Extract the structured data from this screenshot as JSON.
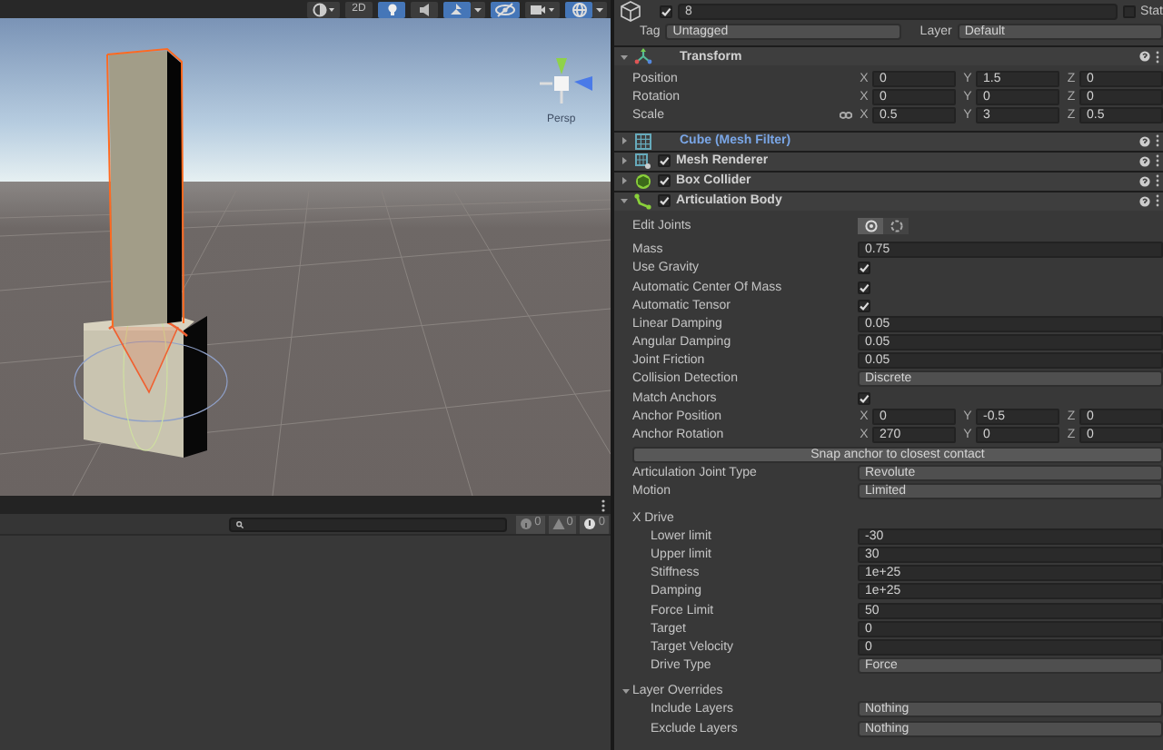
{
  "scene_toolbar": [
    {
      "kind": "shading",
      "on": false
    },
    {
      "kind": "dimension",
      "label": "2D",
      "on": false
    },
    {
      "kind": "lighting",
      "on": true
    },
    {
      "kind": "audio",
      "on": false
    },
    {
      "kind": "effects",
      "on": true
    },
    {
      "kind": "visibility",
      "on": true
    },
    {
      "kind": "camera",
      "on": false
    },
    {
      "kind": "gizmos",
      "on": true
    }
  ],
  "scene": {
    "projection_label": "Persp"
  },
  "console": {
    "counts": [
      {
        "kind": "info",
        "count": "0"
      },
      {
        "kind": "warning",
        "count": "0"
      },
      {
        "kind": "error",
        "count": "0"
      }
    ]
  },
  "inspector": {
    "object": {
      "active": true,
      "name": "8",
      "static_checked": false,
      "static_label": "Stat",
      "tag_label": "Tag",
      "tag": "Untagged",
      "layer_label": "Layer",
      "layer": "Default"
    },
    "components": [
      {
        "kind": "transform",
        "name": "Transform",
        "expanded": true,
        "fields": [
          {
            "label": "Position",
            "linked": false,
            "values": [
              {
                "axis": "X",
                "value": "0"
              },
              {
                "axis": "Y",
                "value": "1.5"
              },
              {
                "axis": "Z",
                "value": "0"
              }
            ]
          },
          {
            "label": "Rotation",
            "linked": false,
            "values": [
              {
                "axis": "X",
                "value": "0"
              },
              {
                "axis": "Y",
                "value": "0"
              },
              {
                "axis": "Z",
                "value": "0"
              }
            ]
          },
          {
            "label": "Scale",
            "linked": true,
            "values": [
              {
                "axis": "X",
                "value": "0.5"
              },
              {
                "axis": "Y",
                "value": "3"
              },
              {
                "axis": "Z",
                "value": "0.5"
              }
            ]
          }
        ]
      },
      {
        "kind": "mesh_filter",
        "name": "Cube (Mesh Filter)",
        "expanded": false
      },
      {
        "kind": "mesh_renderer",
        "name": "Mesh Renderer",
        "expanded": false,
        "enabled": true
      },
      {
        "kind": "box_collider",
        "name": "Box Collider",
        "expanded": false,
        "enabled": true
      },
      {
        "kind": "articulation_body",
        "name": "Articulation Body",
        "expanded": true,
        "enabled": true,
        "properties": [
          {
            "kind": "edit_joints",
            "label": "Edit Joints",
            "modes": [
              {
                "selected": true
              },
              {
                "selected": false
              }
            ]
          },
          {
            "kind": "number",
            "label": "Mass",
            "value": "0.75"
          },
          {
            "kind": "checkbox",
            "label": "Use Gravity",
            "checked": true
          },
          {
            "kind": "checkbox",
            "label": "Automatic Center Of Mass",
            "checked": true
          },
          {
            "kind": "checkbox",
            "label": "Automatic Tensor",
            "checked": true
          },
          {
            "kind": "number",
            "label": "Linear Damping",
            "value": "0.05"
          },
          {
            "kind": "number",
            "label": "Angular Damping",
            "value": "0.05"
          },
          {
            "kind": "number",
            "label": "Joint Friction",
            "value": "0.05"
          },
          {
            "kind": "dropdown",
            "label": "Collision Detection",
            "value": "Discrete"
          },
          {
            "kind": "checkbox",
            "label": "Match Anchors",
            "checked": true
          },
          {
            "kind": "vector3",
            "label": "Anchor Position",
            "values": [
              {
                "axis": "X",
                "value": "0"
              },
              {
                "axis": "Y",
                "value": "-0.5"
              },
              {
                "axis": "Z",
                "value": "0"
              }
            ]
          },
          {
            "kind": "vector3",
            "label": "Anchor Rotation",
            "values": [
              {
                "axis": "X",
                "value": "270"
              },
              {
                "axis": "Y",
                "value": "0"
              },
              {
                "axis": "Z",
                "value": "0"
              }
            ]
          },
          {
            "kind": "button",
            "label": "Snap anchor to closest contact"
          },
          {
            "kind": "dropdown",
            "label": "Articulation Joint Type",
            "value": "Revolute"
          },
          {
            "kind": "dropdown",
            "label": "Motion",
            "value": "Limited"
          },
          {
            "kind": "group",
            "label": "X Drive",
            "children": [
              {
                "kind": "number",
                "label": "Lower limit",
                "value": "-30"
              },
              {
                "kind": "number",
                "label": "Upper limit",
                "value": "30"
              },
              {
                "kind": "number",
                "label": "Stiffness",
                "value": "1e+25"
              },
              {
                "kind": "number",
                "label": "Damping",
                "value": "1e+25"
              },
              {
                "kind": "number",
                "label": "Force Limit",
                "value": "50"
              },
              {
                "kind": "number",
                "label": "Target",
                "value": "0"
              },
              {
                "kind": "number",
                "label": "Target Velocity",
                "value": "0"
              },
              {
                "kind": "dropdown",
                "label": "Drive Type",
                "value": "Force"
              }
            ]
          },
          {
            "kind": "foldout",
            "label": "Layer Overrides",
            "expanded": true,
            "children": [
              {
                "kind": "dropdown",
                "label": "Include Layers",
                "value": "Nothing"
              },
              {
                "kind": "dropdown",
                "label": "Exclude Layers",
                "value": "Nothing"
              }
            ]
          }
        ]
      }
    ]
  }
}
